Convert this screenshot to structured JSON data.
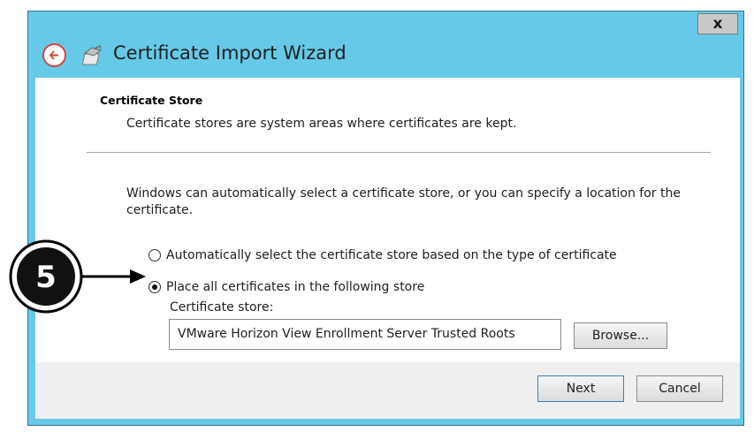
{
  "window": {
    "title": "Certificate Import Wizard",
    "close_label": "x"
  },
  "content": {
    "heading": "Certificate Store",
    "subtext": "Certificate stores are system areas where certificates are kept.",
    "description": "Windows can automatically select a certificate store, or you can specify a location for the certificate.",
    "options": [
      {
        "label": "Automatically select the certificate store based on the type of certificate",
        "selected": false
      },
      {
        "label": "Place all certificates in the following store",
        "selected": true
      }
    ],
    "store_label": "Certificate store:",
    "store_value": "VMware Horizon View Enrollment Server Trusted Roots",
    "browse_label": "Browse..."
  },
  "footer": {
    "next_label": "Next",
    "cancel_label": "Cancel"
  },
  "annotation": {
    "step_number": "5"
  },
  "colors": {
    "title_bar": "#67c9e8",
    "back_button": "#d2473e"
  }
}
